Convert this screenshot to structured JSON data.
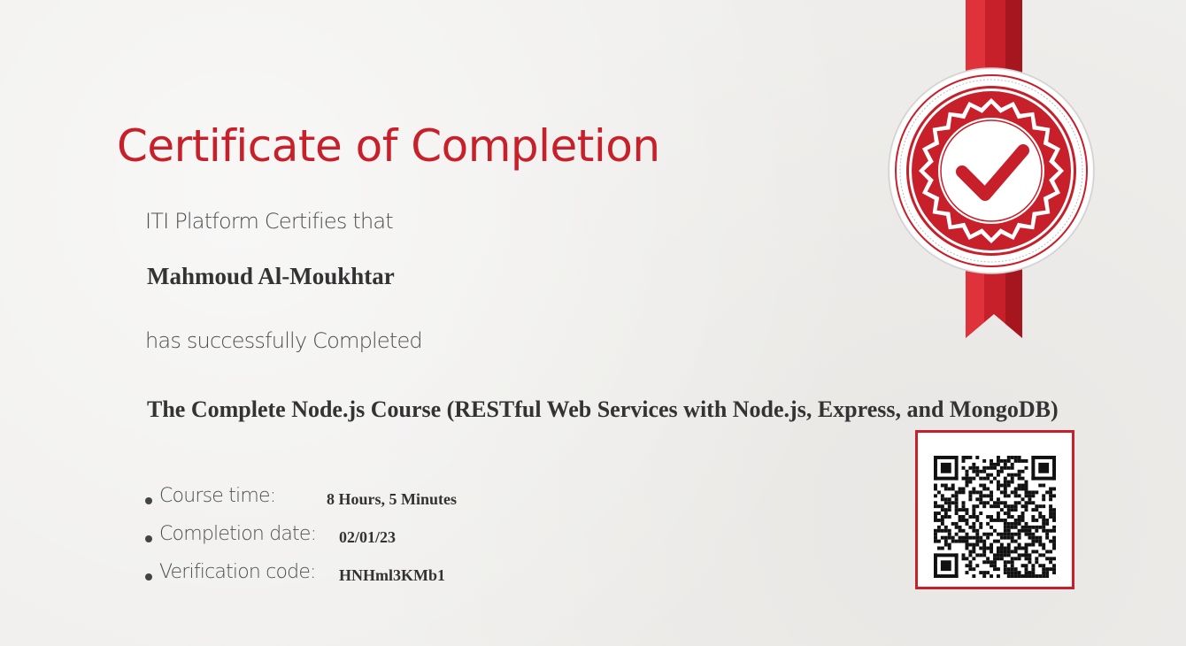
{
  "certificate": {
    "title": "Certificate of Completion",
    "certifier_line": "ITI Platform Certifies that",
    "recipient_name": "Mahmoud Al-Moukhtar",
    "completed_line": "has successfully Completed",
    "course_name": "The Complete Node.js Course (RESTful Web Services with Node.js, Express, and MongoDB)",
    "details": [
      {
        "label": "Course time:",
        "value": "8 Hours, 5 Minutes"
      },
      {
        "label": "Completion date:",
        "value": "02/01/23"
      },
      {
        "label": "Verification code:",
        "value": "HNHml3KMb1"
      }
    ]
  },
  "seal": {
    "icon": "checkmark-rosette-icon",
    "color": "#c8202a"
  },
  "qr_code": {
    "icon": "qr-code-icon",
    "frame_color": "#c8202a"
  },
  "colors": {
    "accent": "#c8202a",
    "text": "#333333",
    "background": "#efeeec"
  }
}
